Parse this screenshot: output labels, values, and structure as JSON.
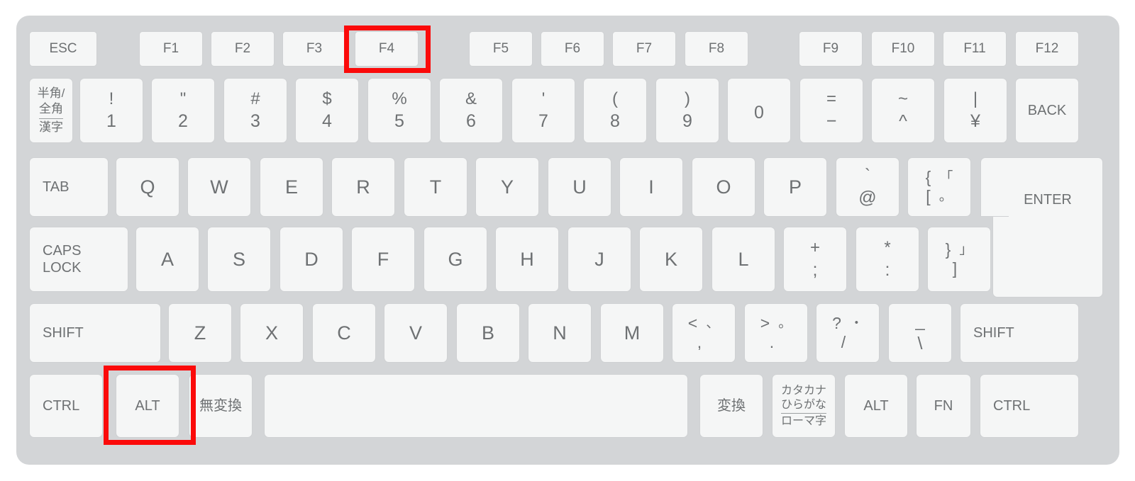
{
  "diagram": {
    "device": "japanese-jis-keyboard",
    "highlight_color": "#fb0a0a",
    "body_color": "#d3d5d7",
    "key_face_color": "#f5f6f6",
    "key_border_color": "#cfd1d3",
    "legend_color": "#6e7173",
    "page_background": "#ffffff",
    "highlighted_keys": [
      "F4",
      "ALT"
    ]
  },
  "rows": {
    "function_row": [
      {
        "id": "esc",
        "label": "ESC"
      },
      {
        "id": "f1",
        "label": "F1"
      },
      {
        "id": "f2",
        "label": "F2"
      },
      {
        "id": "f3",
        "label": "F3"
      },
      {
        "id": "f4",
        "label": "F4",
        "highlighted": true
      },
      {
        "id": "f5",
        "label": "F5"
      },
      {
        "id": "f6",
        "label": "F6"
      },
      {
        "id": "f7",
        "label": "F7"
      },
      {
        "id": "f8",
        "label": "F8"
      },
      {
        "id": "f9",
        "label": "F9"
      },
      {
        "id": "f10",
        "label": "F10"
      },
      {
        "id": "f11",
        "label": "F11"
      },
      {
        "id": "f12",
        "label": "F12"
      }
    ],
    "number_row": [
      {
        "id": "hankaku",
        "line1": "半角/",
        "line2": "全角",
        "line3": "漢字"
      },
      {
        "id": "d1",
        "top": "!",
        "bot": "1"
      },
      {
        "id": "d2",
        "top": "\"",
        "bot": "2"
      },
      {
        "id": "d3",
        "top": "#",
        "bot": "3"
      },
      {
        "id": "d4",
        "top": "$",
        "bot": "4"
      },
      {
        "id": "d5",
        "top": "%",
        "bot": "5"
      },
      {
        "id": "d6",
        "top": "&",
        "bot": "6"
      },
      {
        "id": "d7",
        "top": "'",
        "bot": "7"
      },
      {
        "id": "d8",
        "top": "(",
        "bot": "8"
      },
      {
        "id": "d9",
        "top": ")",
        "bot": "9"
      },
      {
        "id": "d0",
        "top": "",
        "bot": "0"
      },
      {
        "id": "equal",
        "top": "=",
        "bot": "−"
      },
      {
        "id": "caret",
        "top": "~",
        "bot": "^"
      },
      {
        "id": "yen",
        "top": "|",
        "bot": "¥"
      },
      {
        "id": "back",
        "label": "BACK"
      }
    ],
    "tab_row": [
      {
        "id": "tab",
        "label": "TAB"
      },
      {
        "id": "q",
        "label": "Q"
      },
      {
        "id": "w",
        "label": "W"
      },
      {
        "id": "e",
        "label": "E"
      },
      {
        "id": "r",
        "label": "R"
      },
      {
        "id": "t",
        "label": "T"
      },
      {
        "id": "y",
        "label": "Y"
      },
      {
        "id": "u",
        "label": "U"
      },
      {
        "id": "i",
        "label": "I"
      },
      {
        "id": "o",
        "label": "O"
      },
      {
        "id": "p",
        "label": "P"
      },
      {
        "id": "at",
        "top": "`",
        "bot": "@"
      },
      {
        "id": "bracket_l",
        "top_a": "{",
        "top_b": "「",
        "bot_a": "[",
        "bot_b": "。"
      },
      {
        "id": "enter",
        "label": "ENTER"
      }
    ],
    "home_row": [
      {
        "id": "capslock",
        "line1": "CAPS",
        "line2": "LOCK"
      },
      {
        "id": "a",
        "label": "A"
      },
      {
        "id": "s",
        "label": "S"
      },
      {
        "id": "d",
        "label": "D"
      },
      {
        "id": "f",
        "label": "F"
      },
      {
        "id": "g",
        "label": "G"
      },
      {
        "id": "h",
        "label": "H"
      },
      {
        "id": "j",
        "label": "J"
      },
      {
        "id": "k",
        "label": "K"
      },
      {
        "id": "l",
        "label": "L"
      },
      {
        "id": "semicolon",
        "top": "+",
        "bot": ";"
      },
      {
        "id": "colon",
        "top": "*",
        "bot": ":"
      },
      {
        "id": "bracket_r",
        "top_a": "}",
        "top_b": "」",
        "bot_a": "]",
        "bot_b": ""
      }
    ],
    "shift_row": [
      {
        "id": "shift_left",
        "label": "SHIFT"
      },
      {
        "id": "z",
        "label": "Z"
      },
      {
        "id": "x",
        "label": "X"
      },
      {
        "id": "c",
        "label": "C"
      },
      {
        "id": "v",
        "label": "V"
      },
      {
        "id": "b",
        "label": "B"
      },
      {
        "id": "n",
        "label": "N"
      },
      {
        "id": "m",
        "label": "M"
      },
      {
        "id": "comma",
        "top_a": "<",
        "top_b": "、",
        "bot_a": ",",
        "bot_b": ""
      },
      {
        "id": "period",
        "top_a": ">",
        "top_b": "。",
        "bot_a": ".",
        "bot_b": ""
      },
      {
        "id": "slash",
        "top_a": "?",
        "top_b": "・",
        "bot_a": "/",
        "bot_b": ""
      },
      {
        "id": "underscore",
        "top": "_",
        "bot": "\\"
      },
      {
        "id": "shift_right",
        "label": "SHIFT"
      }
    ],
    "bottom_row": [
      {
        "id": "ctrl_left",
        "label": "CTRL"
      },
      {
        "id": "alt_left",
        "label": "ALT",
        "highlighted": true
      },
      {
        "id": "muhenkan",
        "label": "無変換"
      },
      {
        "id": "space",
        "label": ""
      },
      {
        "id": "henkan",
        "label": "変換"
      },
      {
        "id": "katakana",
        "line1": "カタカナ",
        "line2": "ひらがな",
        "line3": "ローマ字"
      },
      {
        "id": "alt_right",
        "label": "ALT"
      },
      {
        "id": "fn",
        "label": "FN"
      },
      {
        "id": "ctrl_right",
        "label": "CTRL"
      }
    ]
  }
}
